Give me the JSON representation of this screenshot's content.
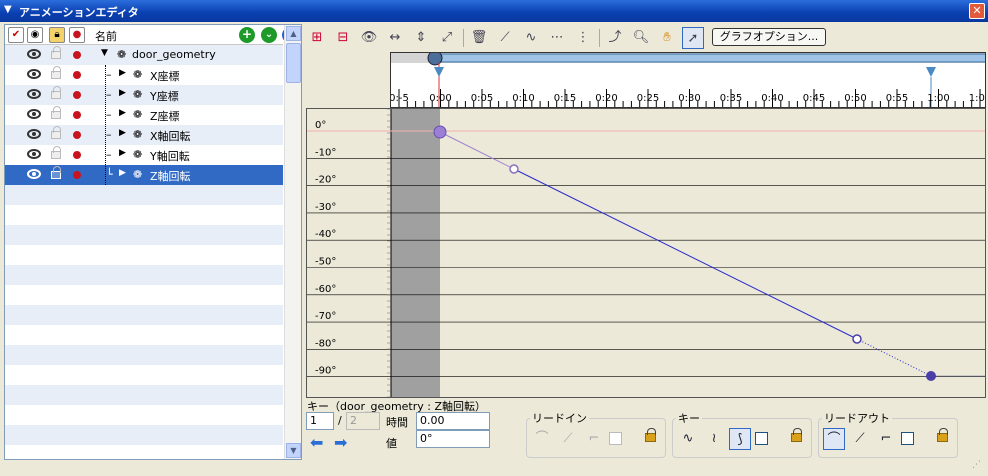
{
  "window": {
    "title": "アニメーションエディタ",
    "close_glyph": "✕",
    "collapse_glyph": "▼"
  },
  "left_panel": {
    "header": {
      "name_col": "名前",
      "add_glyph": "+",
      "down_glyph": "⌄",
      "back_glyph": "«"
    },
    "rows": [
      {
        "label": "door_geometry",
        "level": 0,
        "expander": "▼"
      },
      {
        "label": "X座標",
        "level": 1,
        "expander": "▶"
      },
      {
        "label": "Y座標",
        "level": 1,
        "expander": "▶"
      },
      {
        "label": "Z座標",
        "level": 1,
        "expander": "▶"
      },
      {
        "label": "X軸回転",
        "level": 1,
        "expander": "▶"
      },
      {
        "label": "Y軸回転",
        "level": 1,
        "expander": "▶"
      },
      {
        "label": "Z軸回転",
        "level": 1,
        "expander": "▶",
        "selected": true
      }
    ]
  },
  "toolbar": {
    "graph_options_label": "グラフオプション..."
  },
  "timeline": {
    "ticks": [
      "0:-5",
      "0:00",
      "0:05",
      "0:10",
      "0:15",
      "0:20",
      "0:25",
      "0:30",
      "0:35",
      "0:40",
      "0:45",
      "0:50",
      "0:55",
      "1:00",
      "1:05"
    ],
    "current_time": "0:00",
    "end_marker": "1:00"
  },
  "graph": {
    "y_labels": [
      "0°",
      "-10°",
      "-20°",
      "-30°",
      "-40°",
      "-50°",
      "-60°",
      "-70°",
      "-80°",
      "-90°"
    ],
    "curve_color": "#2a2acc",
    "key_color": "#4a3fa8",
    "start_key_color": "#9b7fd4"
  },
  "bottom": {
    "key_label": "キー（door_geometry : Z軸回転）",
    "key_index": "1",
    "key_total": "2",
    "slash": "/",
    "time_label": "時間",
    "time_value": "0.00",
    "value_label": "値",
    "value_value": "0°",
    "lead_in_label": "リードイン",
    "key_group_label": "キー",
    "lead_out_label": "リードアウト"
  }
}
